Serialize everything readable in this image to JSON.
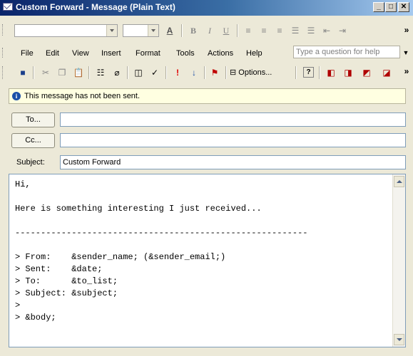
{
  "window": {
    "title": "Custom Forward - Message (Plain Text)"
  },
  "menu": [
    "File",
    "Edit",
    "View",
    "Insert",
    "Format",
    "Tools",
    "Actions",
    "Help"
  ],
  "help_box": {
    "placeholder": "Type a question for help"
  },
  "toolbar": {
    "options_label": "Options..."
  },
  "info_bar": {
    "text": "This message has not been sent."
  },
  "header": {
    "to_label": "To...",
    "cc_label": "Cc...",
    "to_value": "",
    "cc_value": "",
    "subject_label": "Subject:",
    "subject_value": "Custom Forward"
  },
  "body": {
    "text": "Hi,\n\nHere is something interesting I just received...\n\n---------------------------------------------------------\n\n> From:    &sender_name; (&sender_email;)\n> Sent:    &date;\n> To:      &to_list;\n> Subject: &subject;\n>\n> &body;"
  },
  "colors": {
    "titlebar": "#0a246a",
    "info_bg": "#ffffe1",
    "chrome": "#ece9d8"
  }
}
